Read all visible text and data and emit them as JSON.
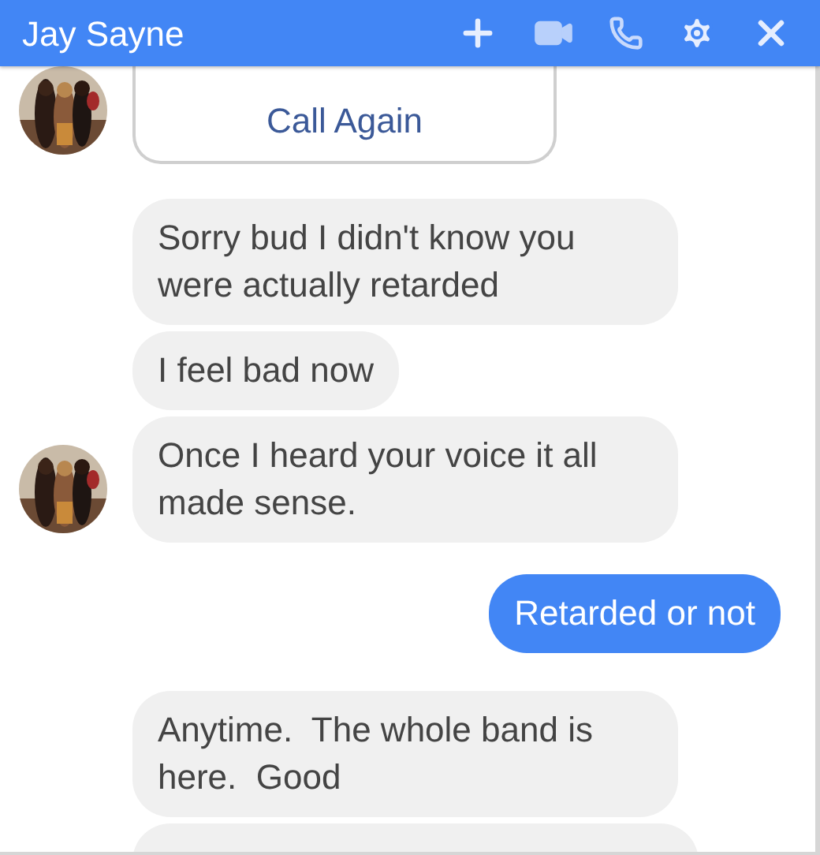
{
  "header": {
    "title": "Jay Sayne"
  },
  "messages": [
    {
      "kind": "call_button",
      "text": "Call Again",
      "avatar": true
    },
    {
      "kind": "incoming",
      "text": "Sorry bud I didn't know you were actually retarded",
      "avatar": false
    },
    {
      "kind": "incoming",
      "text": "I feel bad now",
      "avatar": false
    },
    {
      "kind": "incoming",
      "text": "Once I heard your voice it all made sense.",
      "avatar": true
    },
    {
      "kind": "outgoing",
      "text": "Retarded or not"
    },
    {
      "kind": "incoming",
      "text": "Anytime.  The whole band is here.  Good",
      "avatar": false
    },
    {
      "kind": "incoming_cut",
      "avatar": false
    }
  ]
}
